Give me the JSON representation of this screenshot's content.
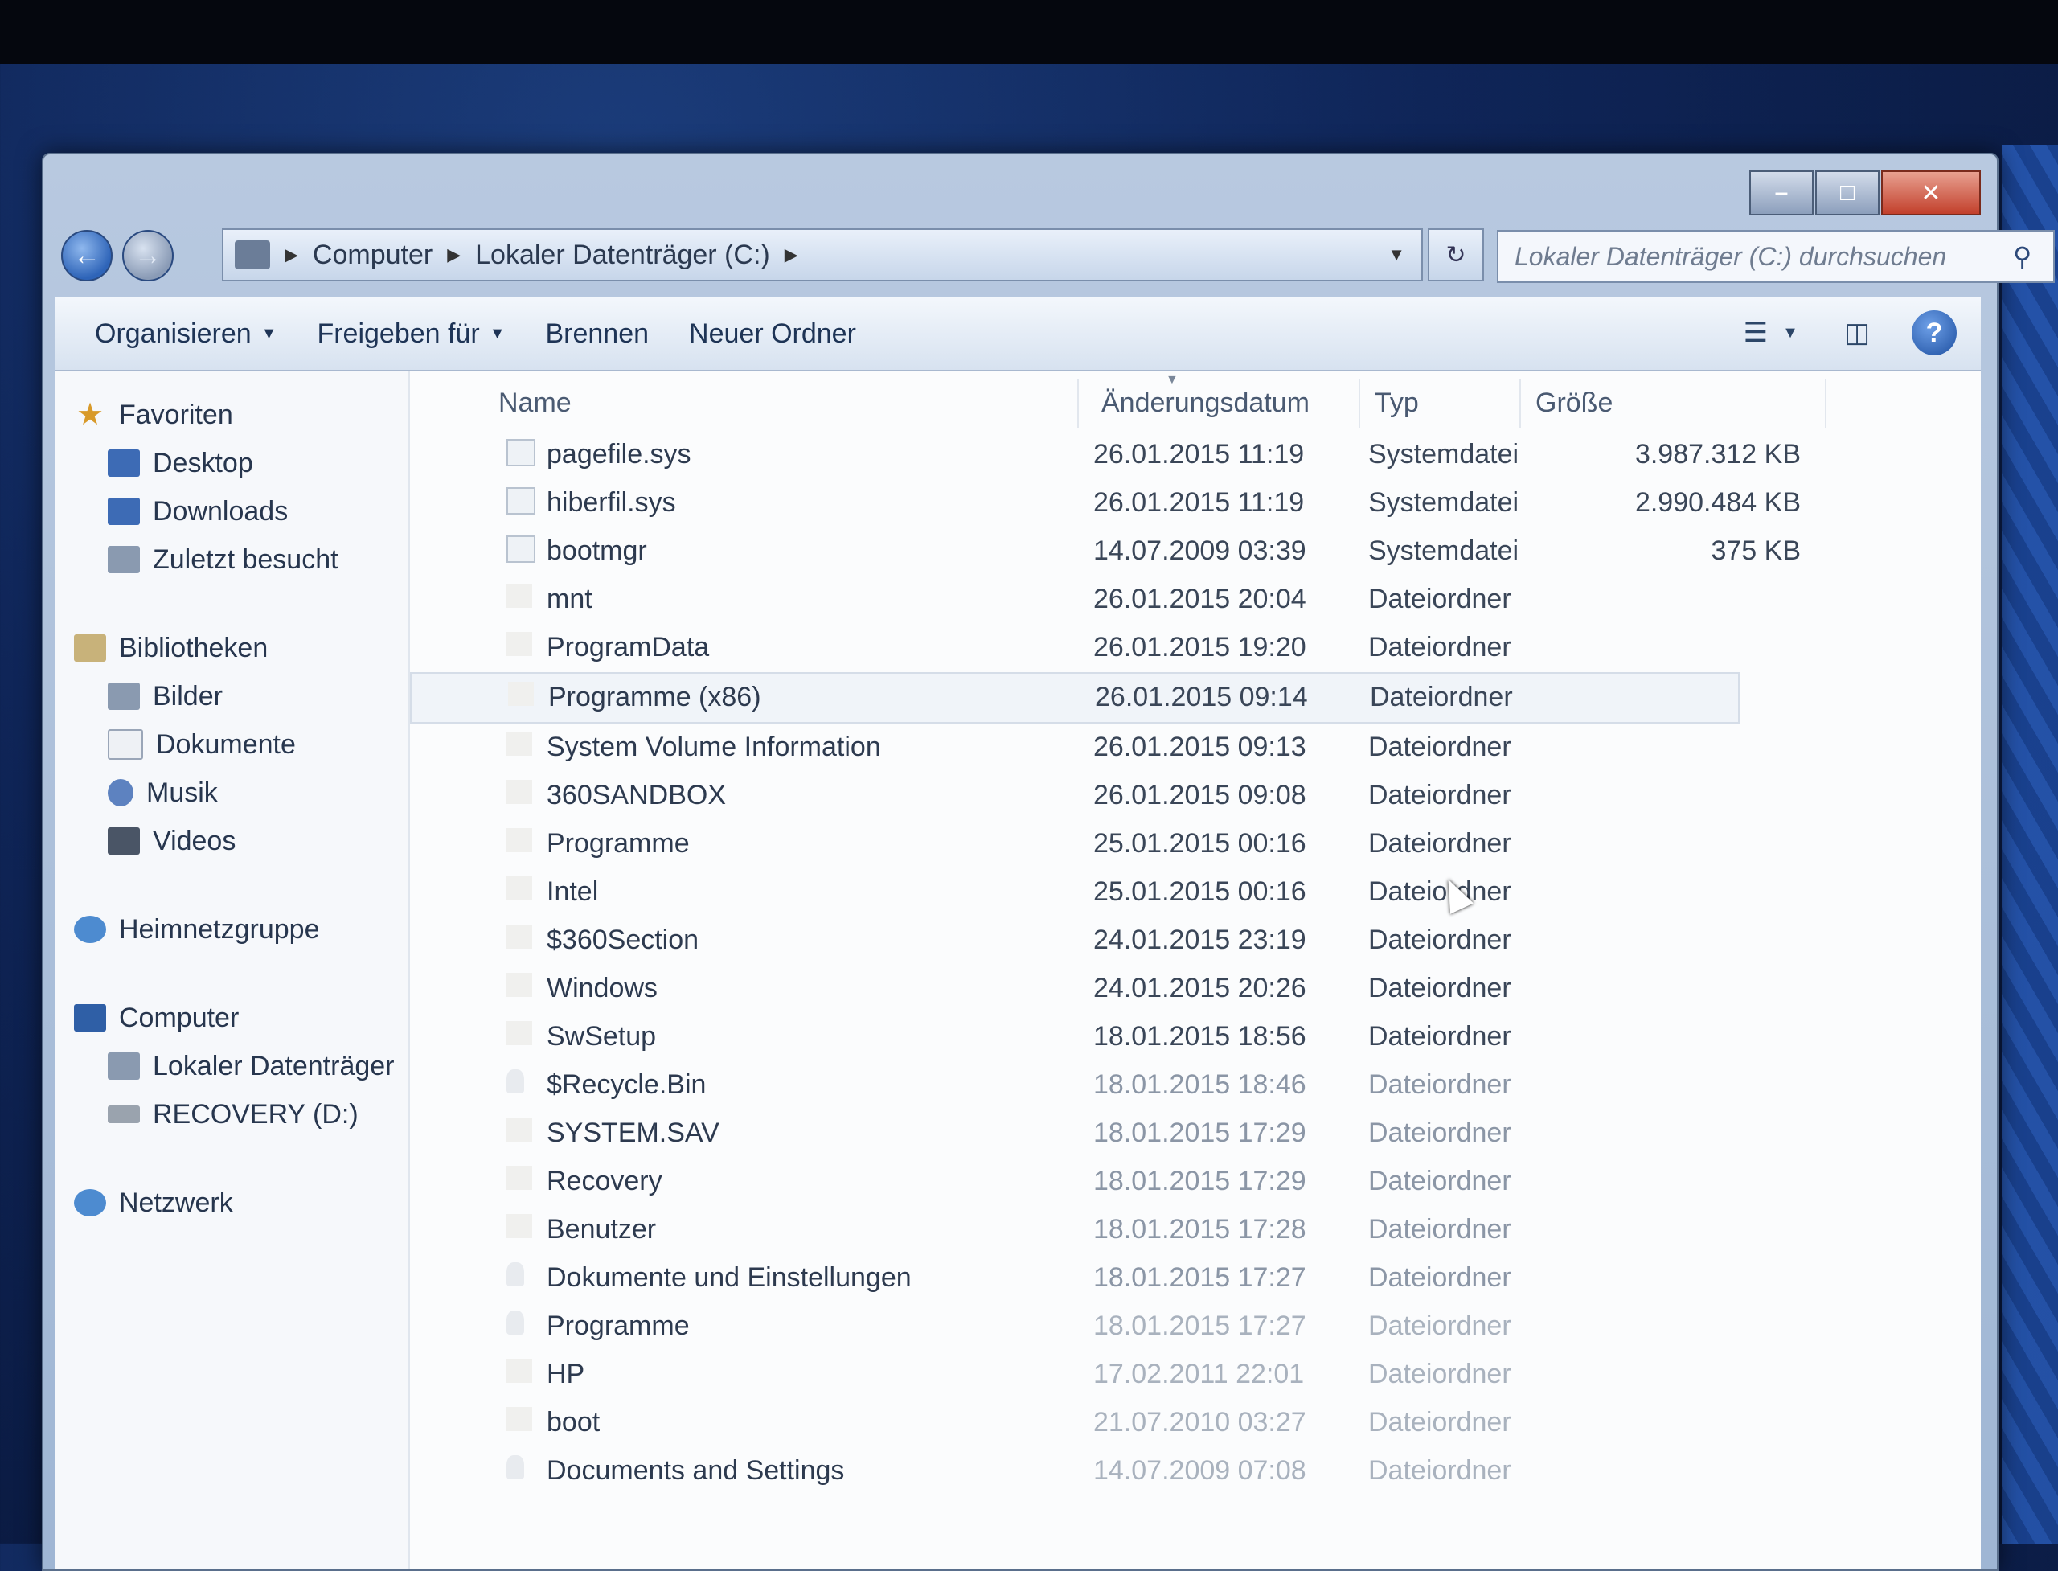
{
  "window": {
    "controls": {
      "minimize": "–",
      "maximize": "□",
      "close": "✕"
    }
  },
  "nav": {
    "back_icon": "back-arrow-icon",
    "forward_icon": "forward-arrow-icon",
    "breadcrumb": [
      "Computer",
      "Lokaler Datenträger (C:)"
    ],
    "search_placeholder": "Lokaler Datenträger (C:) durchsuchen"
  },
  "toolbar": {
    "organize": "Organisieren",
    "share": "Freigeben für",
    "burn": "Brennen",
    "new_folder": "Neuer Ordner"
  },
  "sidebar": {
    "favorites": {
      "label": "Favoriten",
      "items": [
        "Desktop",
        "Downloads",
        "Zuletzt besucht"
      ]
    },
    "libraries": {
      "label": "Bibliotheken",
      "items": [
        "Bilder",
        "Dokumente",
        "Musik",
        "Videos"
      ]
    },
    "homegroup": {
      "label": "Heimnetzgruppe"
    },
    "computer": {
      "label": "Computer",
      "items": [
        "Lokaler Datenträger",
        "RECOVERY (D:)"
      ]
    },
    "network": {
      "label": "Netzwerk"
    }
  },
  "columns": {
    "name": "Name",
    "date": "Änderungsdatum",
    "type": "Typ",
    "size": "Größe"
  },
  "files": [
    {
      "name": "pagefile.sys",
      "date": "26.01.2015 11:19",
      "type": "Systemdatei",
      "size": "3.987.312 KB"
    },
    {
      "name": "hiberfil.sys",
      "date": "26.01.2015 11:19",
      "type": "Systemdatei",
      "size": "2.990.484 KB"
    },
    {
      "name": "bootmgr",
      "date": "14.07.2009 03:39",
      "type": "Systemdatei",
      "size": "375 KB"
    },
    {
      "name": "mnt",
      "date": "26.01.2015 20:04",
      "type": "Dateiordner",
      "size": ""
    },
    {
      "name": "ProgramData",
      "date": "26.01.2015 19:20",
      "type": "Dateiordner",
      "size": ""
    },
    {
      "name": "Programme (x86)",
      "date": "26.01.2015 09:14",
      "type": "Dateiordner",
      "size": ""
    },
    {
      "name": "System Volume Information",
      "date": "26.01.2015 09:13",
      "type": "Dateiordner",
      "size": ""
    },
    {
      "name": "360SANDBOX",
      "date": "26.01.2015 09:08",
      "type": "Dateiordner",
      "size": ""
    },
    {
      "name": "Programme",
      "date": "25.01.2015 00:16",
      "type": "Dateiordner",
      "size": ""
    },
    {
      "name": "Intel",
      "date": "25.01.2015 00:16",
      "type": "Dateiordner",
      "size": ""
    },
    {
      "name": "$360Section",
      "date": "24.01.2015 23:19",
      "type": "Dateiordner",
      "size": ""
    },
    {
      "name": "Windows",
      "date": "24.01.2015 20:26",
      "type": "Dateiordner",
      "size": ""
    },
    {
      "name": "SwSetup",
      "date": "18.01.2015 18:56",
      "type": "Dateiordner",
      "size": ""
    },
    {
      "name": "$Recycle.Bin",
      "date": "18.01.2015 18:46",
      "type": "Dateiordner",
      "size": ""
    },
    {
      "name": "SYSTEM.SAV",
      "date": "18.01.2015 17:29",
      "type": "Dateiordner",
      "size": ""
    },
    {
      "name": "Recovery",
      "date": "18.01.2015 17:29",
      "type": "Dateiordner",
      "size": ""
    },
    {
      "name": "Benutzer",
      "date": "18.01.2015 17:28",
      "type": "Dateiordner",
      "size": ""
    },
    {
      "name": "Dokumente und Einstellungen",
      "date": "18.01.2015 17:27",
      "type": "Dateiordner",
      "size": ""
    },
    {
      "name": "Programme",
      "date": "18.01.2015 17:27",
      "type": "Dateiordner",
      "size": ""
    },
    {
      "name": "HP",
      "date": "17.02.2011 22:01",
      "type": "Dateiordner",
      "size": ""
    },
    {
      "name": "boot",
      "date": "21.07.2010 03:27",
      "type": "Dateiordner",
      "size": ""
    },
    {
      "name": "Documents and Settings",
      "date": "14.07.2009 07:08",
      "type": "Dateiordner",
      "size": ""
    }
  ],
  "selected_row": "Programme (x86)"
}
